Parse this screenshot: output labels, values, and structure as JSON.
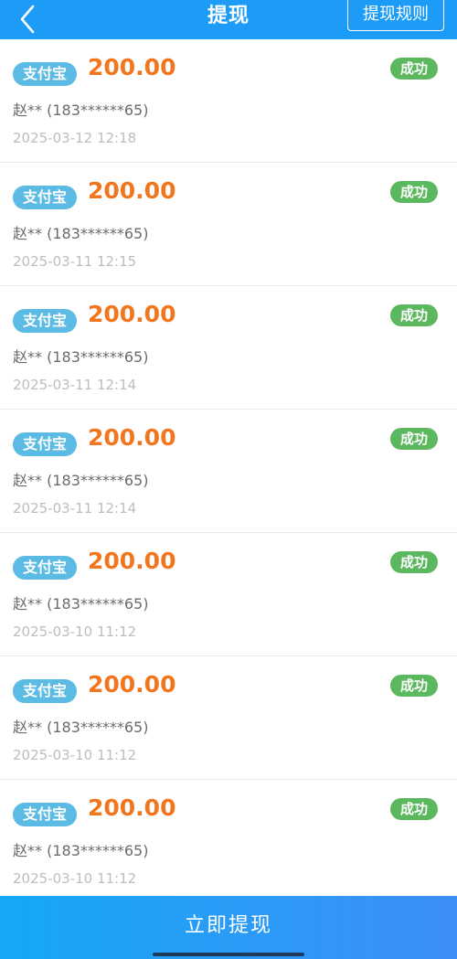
{
  "header": {
    "title": "提现",
    "rules_label": "提现规则"
  },
  "records": [
    {
      "channel": "支付宝",
      "amount": "200.00",
      "status": "成功",
      "account": "赵** (183******65)",
      "time": "2025-03-12 12:18"
    },
    {
      "channel": "支付宝",
      "amount": "200.00",
      "status": "成功",
      "account": "赵** (183******65)",
      "time": "2025-03-11 12:15"
    },
    {
      "channel": "支付宝",
      "amount": "200.00",
      "status": "成功",
      "account": "赵** (183******65)",
      "time": "2025-03-11 12:14"
    },
    {
      "channel": "支付宝",
      "amount": "200.00",
      "status": "成功",
      "account": "赵** (183******65)",
      "time": "2025-03-11 12:14"
    },
    {
      "channel": "支付宝",
      "amount": "200.00",
      "status": "成功",
      "account": "赵** (183******65)",
      "time": "2025-03-10 11:12"
    },
    {
      "channel": "支付宝",
      "amount": "200.00",
      "status": "成功",
      "account": "赵** (183******65)",
      "time": "2025-03-10 11:12"
    },
    {
      "channel": "支付宝",
      "amount": "200.00",
      "status": "成功",
      "account": "赵** (183******65)",
      "time": "2025-03-10 11:12"
    }
  ],
  "footer": {
    "withdraw_label": "立即提现"
  },
  "colors": {
    "header_bg": "#1c9cf6",
    "channel_badge": "#5bbbe4",
    "amount": "#f2761e",
    "status_success": "#5bb85e"
  },
  "icons": {
    "back": "chevron-left-icon"
  }
}
